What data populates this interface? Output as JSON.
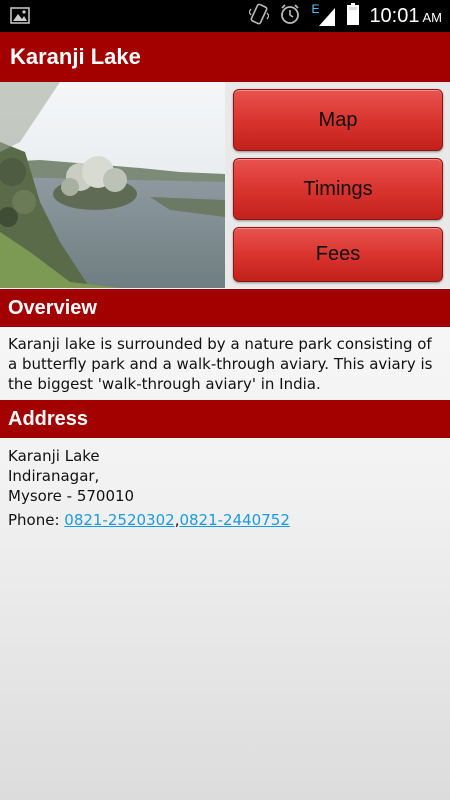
{
  "status_bar": {
    "time": "10:01",
    "ampm": "AM",
    "network_label": "E",
    "icons": [
      "gallery-icon",
      "vibrate-icon",
      "alarm-icon",
      "signal-icon",
      "battery-icon"
    ]
  },
  "header": {
    "title": "Karanji Lake"
  },
  "buttons": {
    "map": "Map",
    "timings": "Timings",
    "fees": "Fees"
  },
  "overview": {
    "heading": "Overview",
    "text": "Karanji lake is surrounded by a nature park consisting of a butterfly park and a walk-through aviary. This aviary is the biggest 'walk-through aviary' in India."
  },
  "address": {
    "heading": "Address",
    "line1": "Karanji Lake",
    "line2": "Indiranagar,",
    "line3": "Mysore - 570010",
    "phone_label": "Phone: ",
    "phone1": "0821-2520302",
    "separator": ",",
    "phone2": "0821-2440752"
  },
  "colors": {
    "header_bg": "#a30000",
    "button_red": "#d8322d",
    "link": "#1a9ae0"
  }
}
